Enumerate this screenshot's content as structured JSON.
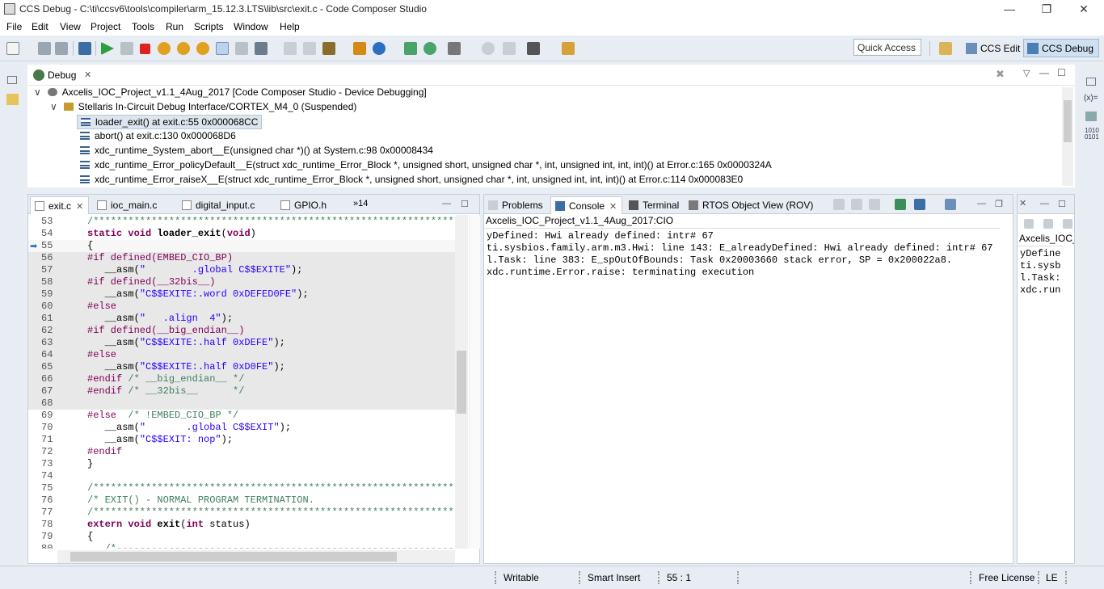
{
  "window": {
    "title": "CCS Debug - C:\\ti\\ccsv6\\tools\\compiler\\arm_15.12.3.LTS\\lib\\src\\exit.c - Code Composer Studio",
    "minimize": "—",
    "restore": "❐",
    "close": "✕"
  },
  "menu": [
    "File",
    "Edit",
    "View",
    "Project",
    "Tools",
    "Run",
    "Scripts",
    "Window",
    "Help"
  ],
  "toolbar": {
    "quick_access": "Quick Access",
    "perspectives": [
      {
        "label": "CCS Edit",
        "active": false
      },
      {
        "label": "CCS Debug",
        "active": true
      }
    ]
  },
  "debug_view": {
    "tab_label": "Debug",
    "rows": [
      {
        "text": "Axcelis_IOC_Project_v1.1_4Aug_2017 [Code Composer Studio - Device Debugging]",
        "level": 0,
        "expander": "∨"
      },
      {
        "text": "Stellaris In-Circuit Debug Interface/CORTEX_M4_0 (Suspended)",
        "level": 1,
        "expander": "∨"
      },
      {
        "text": "loader_exit() at exit.c:55 0x000068CC",
        "level": 2,
        "selected": true
      },
      {
        "text": "abort() at exit.c:130 0x000068D6",
        "level": 2
      },
      {
        "text": "xdc_runtime_System_abort__E(unsigned char *)() at System.c:98 0x00008434",
        "level": 2
      },
      {
        "text": "xdc_runtime_Error_policyDefault__E(struct xdc_runtime_Error_Block *, unsigned short, unsigned char *, int, unsigned int, int, int)() at Error.c:165 0x0000324A",
        "level": 2
      },
      {
        "text": "xdc_runtime_Error_raiseX__E(struct xdc_runtime_Error_Block *, unsigned short, unsigned char *, int, unsigned int, int, int)() at Error.c:114 0x000083E0",
        "level": 2
      }
    ]
  },
  "editor": {
    "tabs": [
      {
        "label": "exit.c",
        "active": true
      },
      {
        "label": "ioc_main.c"
      },
      {
        "label": "digital_input.c"
      },
      {
        "label": "GPIO.h"
      }
    ],
    "overflow": "»14",
    "lines": [
      {
        "n": "53",
        "t": "/*************************************************************************",
        "c": "cm"
      },
      {
        "n": "54",
        "t": "static void loader_exit(void)",
        "c": "decl"
      },
      {
        "n": "55",
        "t": "{",
        "c": "plain",
        "cur": true
      },
      {
        "n": "56",
        "t": "#if defined(EMBED_CIO_BP)",
        "c": "pp",
        "hl": true
      },
      {
        "n": "57",
        "t": "   __asm(\"        .global C$$EXITE\");",
        "c": "asm",
        "hl": true
      },
      {
        "n": "58",
        "t": "#if defined(__32bis__)",
        "c": "pp",
        "hl": true
      },
      {
        "n": "59",
        "t": "   __asm(\"C$$EXITE:.word 0xDEFED0FE\");",
        "c": "asm",
        "hl": true
      },
      {
        "n": "60",
        "t": "#else",
        "c": "pp",
        "hl": true
      },
      {
        "n": "61",
        "t": "   __asm(\"   .align  4\");",
        "c": "asm",
        "hl": true
      },
      {
        "n": "62",
        "t": "#if defined(__big_endian__)",
        "c": "pp",
        "hl": true
      },
      {
        "n": "63",
        "t": "   __asm(\"C$$EXITE:.half 0xDEFE\");",
        "c": "asm",
        "hl": true
      },
      {
        "n": "64",
        "t": "#else",
        "c": "pp",
        "hl": true
      },
      {
        "n": "65",
        "t": "   __asm(\"C$$EXITE:.half 0xD0FE\");",
        "c": "asm",
        "hl": true
      },
      {
        "n": "66",
        "t": "#endif /* __big_endian__ */",
        "c": "ppc",
        "hl": true
      },
      {
        "n": "67",
        "t": "#endif /* __32bis__      */",
        "c": "ppc",
        "hl": true
      },
      {
        "n": "68",
        "t": "",
        "c": "plain",
        "hl": true
      },
      {
        "n": "69",
        "t": "#else  /* !EMBED_CIO_BP */",
        "c": "ppc"
      },
      {
        "n": "70",
        "t": "   __asm(\"       .global C$$EXIT\");",
        "c": "asm"
      },
      {
        "n": "71",
        "t": "   __asm(\"C$$EXIT: nop\");",
        "c": "asm"
      },
      {
        "n": "72",
        "t": "#endif",
        "c": "pp"
      },
      {
        "n": "73",
        "t": "}",
        "c": "plain"
      },
      {
        "n": "74",
        "t": "",
        "c": "plain"
      },
      {
        "n": "75",
        "t": "/*************************************************************************",
        "c": "cm"
      },
      {
        "n": "76",
        "t": "/* EXIT() - NORMAL PROGRAM TERMINATION.",
        "c": "cm"
      },
      {
        "n": "77",
        "t": "/*************************************************************************",
        "c": "cm"
      },
      {
        "n": "78",
        "t": "extern void exit(int status)",
        "c": "decl2"
      },
      {
        "n": "79",
        "t": "{",
        "c": "plain"
      },
      {
        "n": "80",
        "t": "   /*-----------------------------------------------------------------------",
        "c": "cm"
      }
    ]
  },
  "console_view": {
    "tabs": [
      {
        "label": "Problems"
      },
      {
        "label": "Console",
        "active": true
      },
      {
        "label": "Terminal"
      },
      {
        "label": "RTOS Object View (ROV)"
      }
    ],
    "header": "Axcelis_IOC_Project_v1.1_4Aug_2017:CIO",
    "lines": [
      "yDefined: Hwi already defined: intr# 67",
      "ti.sysbios.family.arm.m3.Hwi: line 143: E_alreadyDefined: Hwi already defined: intr# 67",
      "l.Task: line 383: E_spOutOfBounds: Task 0x20003660 stack error, SP = 0x200022a8.",
      "xdc.runtime.Error.raise: terminating execution"
    ]
  },
  "right_view": {
    "header": "Axcelis_IOC_P",
    "lines": [
      "yDefine",
      "ti.sysb",
      "l.Task:",
      "xdc.run"
    ]
  },
  "status": {
    "writable": "Writable",
    "insert_mode": "Smart Insert",
    "position": "55 : 1",
    "license": "Free License",
    "le": "LE"
  },
  "colors": {
    "keyword": "#7f0055",
    "string": "#2a00ff",
    "comment": "#3f7f5f",
    "highlight": "#e8e8e8",
    "selection": "#dde6ef"
  }
}
